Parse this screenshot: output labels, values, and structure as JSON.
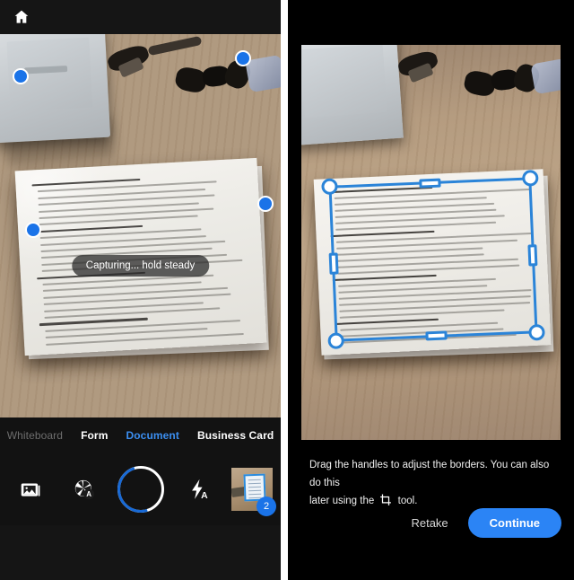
{
  "app": {
    "home_label": "Home"
  },
  "left_panel": {
    "name": "camera-capture-screen",
    "toast": "Capturing... hold steady",
    "modes": [
      {
        "label": "Whiteboard",
        "state": "inactive-dim"
      },
      {
        "label": "Form",
        "state": "inactive"
      },
      {
        "label": "Document",
        "state": "active"
      },
      {
        "label": "Business Card",
        "state": "inactive"
      }
    ],
    "controls": {
      "gallery": "gallery-icon",
      "auto_capture": "auto-capture-aperture-icon",
      "auto_capture_badge": "A",
      "shutter": "shutter-button",
      "flash": "flash-auto-icon",
      "flash_badge": "A",
      "thumbnail": "last-capture-thumbnail",
      "thumbnail_count": "2"
    },
    "corner_handles": 4
  },
  "right_panel": {
    "name": "adjust-borders-screen",
    "hint_line1": "Drag the handles to adjust the borders. You can also do this",
    "hint_line2_before": "later using the",
    "hint_icon": "crop-icon",
    "hint_line2_after": "tool.",
    "retake_label": "Retake",
    "continue_label": "Continue",
    "corner_handles": 4,
    "edge_handles": 4
  },
  "colors": {
    "accent_blue": "#2b84f5",
    "handle_blue": "#2b84d8",
    "corner_dot_blue": "#1a73e8",
    "mode_active_blue": "#3b8ef0",
    "panel_bg": "#121212",
    "badge_blue": "#1a73e8"
  }
}
